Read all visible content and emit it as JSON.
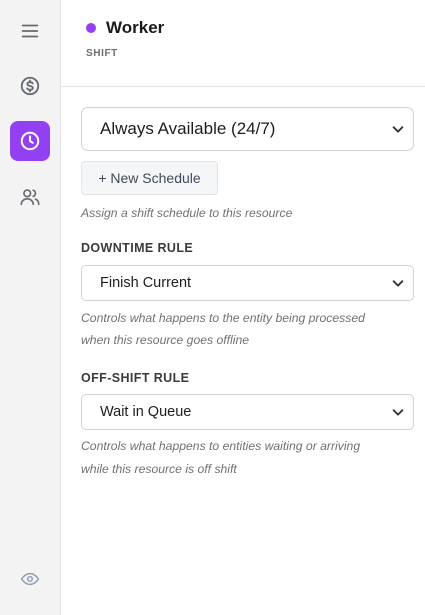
{
  "header": {
    "title": "Worker",
    "subtitle": "SHIFT",
    "status_color": "#9340f2"
  },
  "rail": {
    "items": [
      {
        "icon": "menu-icon",
        "active": false
      },
      {
        "icon": "dollar-icon",
        "active": false
      },
      {
        "icon": "clock-icon",
        "active": true
      },
      {
        "icon": "users-icon",
        "active": false
      },
      {
        "icon": "eye-icon",
        "active": false
      }
    ],
    "accent": "#9340f2"
  },
  "schedule": {
    "selected": "Always Available (24/7)",
    "new_button_label": "+ New Schedule",
    "hint": "Assign a shift schedule to this resource"
  },
  "downtime": {
    "label": "DOWNTIME RULE",
    "selected": "Finish Current",
    "hint_line1": "Controls what happens to the entity being processed",
    "hint_line2": "when this resource goes offline"
  },
  "offshift": {
    "label": "OFF-SHIFT RULE",
    "selected": "Wait in Queue",
    "hint_line1": "Controls what happens to entities waiting or arriving",
    "hint_line2": "while this resource is off shift"
  }
}
